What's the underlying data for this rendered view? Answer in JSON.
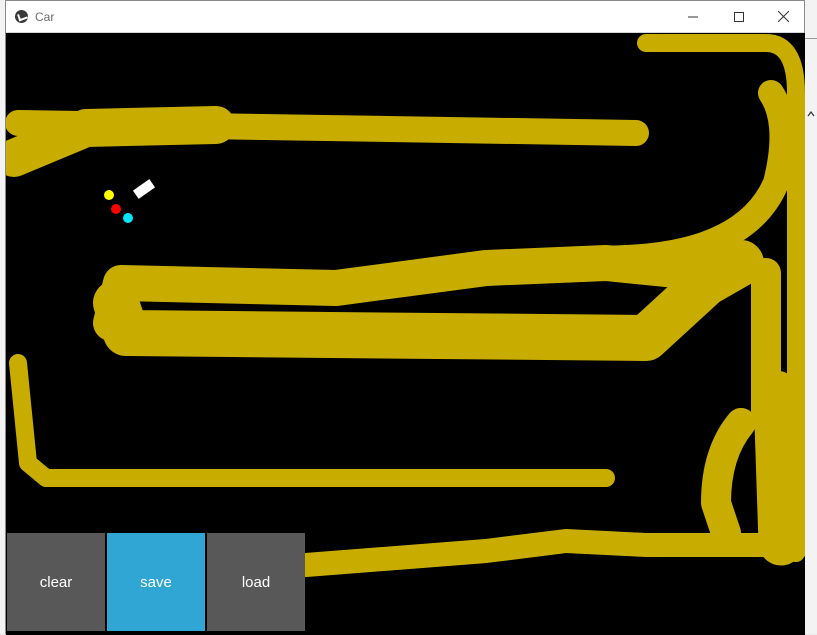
{
  "window": {
    "title": "Car",
    "controls": {
      "minimize_icon": "minimize-icon",
      "maximize_icon": "maximize-icon",
      "close_icon": "close-icon"
    }
  },
  "canvas": {
    "background": "#000000",
    "paint_color": "#c8ad00",
    "car_color": "#ffffff",
    "sensor_colors": [
      "#ffff00",
      "#ff0000",
      "#00e5ff"
    ]
  },
  "buttons": {
    "clear_label": "clear",
    "save_label": "save",
    "load_label": "load"
  },
  "colors": {
    "button_gray": "#585858",
    "button_active": "#2fa6d3"
  }
}
